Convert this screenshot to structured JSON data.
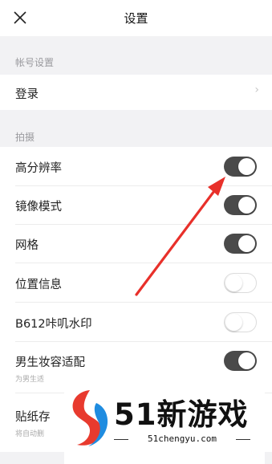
{
  "header": {
    "title": "设置",
    "close_icon": "close-icon"
  },
  "sections": {
    "account": "帐号设置",
    "shooting": "拍摄"
  },
  "login": {
    "label": "登录",
    "chevron": "›"
  },
  "settings": [
    {
      "label": "高分辨率",
      "on": true
    },
    {
      "label": "镜像模式",
      "on": true
    },
    {
      "label": "网格",
      "on": true
    },
    {
      "label": "位置信息",
      "on": false
    },
    {
      "label": "B612咔叽水印",
      "on": false
    },
    {
      "label": "男生妆容适配",
      "on": true,
      "sub": "为男生适"
    },
    {
      "label": "贴纸存",
      "sub": "将自动删"
    }
  ],
  "colors": {
    "toggle_on": "#4a4a4a",
    "arrow": "#e8302a",
    "logo_red": "#e83a2e",
    "logo_blue": "#1f8ce0"
  },
  "watermark": {
    "brand": "51新游戏",
    "url": "51chengyu.com"
  }
}
